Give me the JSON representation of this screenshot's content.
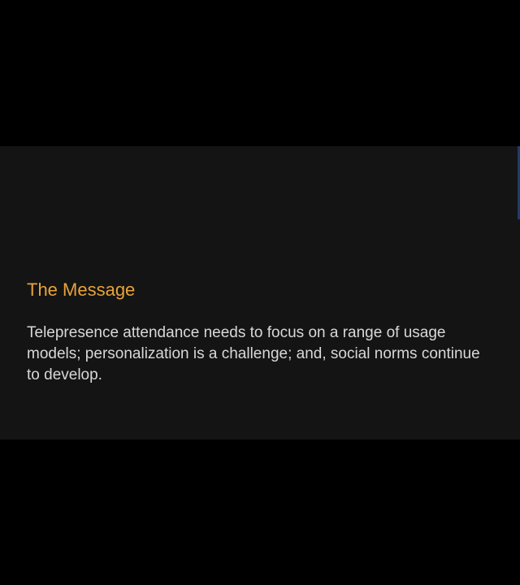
{
  "colors": {
    "background": "#000000",
    "slide_background": "#141414",
    "title_color": "#e8a33a",
    "body_color": "#d8d8d8",
    "edge_accent": "#1f3b66"
  },
  "slide": {
    "title": "The Message",
    "body": "Telepresence attendance needs to focus on a range of usage models; personalization is a challenge; and, social norms continue to develop."
  }
}
